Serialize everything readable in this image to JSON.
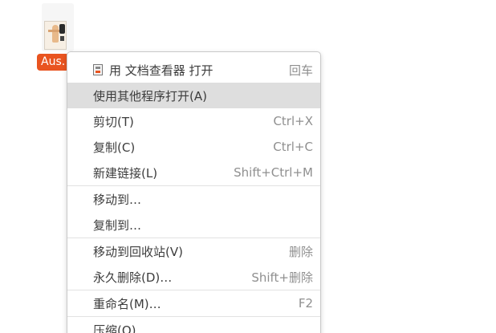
{
  "desktop": {
    "file": {
      "label": "Aus."
    }
  },
  "menu": {
    "items": [
      {
        "label": "用 文档查看器 打开",
        "accel": "回车",
        "icon": "document-viewer-icon"
      },
      {
        "label": "使用其他程序打开(A)",
        "accel": ""
      },
      {
        "label": "剪切(T)",
        "accel": "Ctrl+X"
      },
      {
        "label": "复制(C)",
        "accel": "Ctrl+C"
      },
      {
        "label": "新建链接(L)",
        "accel": "Shift+Ctrl+M"
      },
      {
        "label": "移动到…",
        "accel": ""
      },
      {
        "label": "复制到…",
        "accel": ""
      },
      {
        "label": "移动到回收站(V)",
        "accel": "删除"
      },
      {
        "label": "永久删除(D)…",
        "accel": "Shift+删除"
      },
      {
        "label": "重命名(M)…",
        "accel": "F2"
      },
      {
        "label": "压缩(O)…",
        "accel": ""
      }
    ]
  },
  "colors": {
    "accent": "#e95420",
    "highlight": "#dedede",
    "accel_text": "#8f8f8f"
  }
}
